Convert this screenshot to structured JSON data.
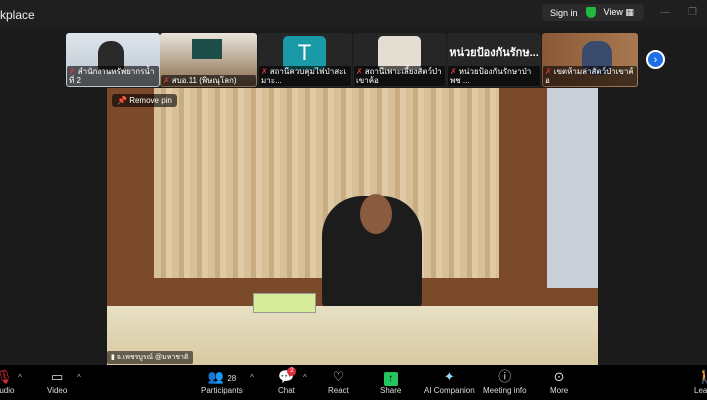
{
  "titlebar": {
    "title": "kplace",
    "sign_in": "Sign in",
    "view": "View"
  },
  "thumbnails": [
    {
      "name": "สำนักงานทรัพยากรน้ำที่ 2",
      "muted": true
    },
    {
      "name": "สบอ.11 (พิษณุโลก)",
      "muted": true
    },
    {
      "name": "สถานีควบคุมไฟป่าสะเมาะ...",
      "muted": true,
      "avatar": "T",
      "avatar_color": "#1a9aa6"
    },
    {
      "name": "สถานีเพาะเลี้ยงสัตว์ป่าเขาค้อ",
      "muted": true,
      "avatar_color": "#e4ddd2"
    },
    {
      "name": "หน่วยป้องกันรักษาป่า พช ...",
      "muted": true,
      "display_name": "หน่วยป้องกันรักษ..."
    },
    {
      "name": "เขตห้ามล่าสัตว์ป่าเขาค้อ",
      "muted": true
    }
  ],
  "main": {
    "remove_pin": "Remove pin",
    "speaker": "จ.เพชรบูรณ์ @มหาชาติ"
  },
  "toolbar": {
    "audio": "Audio",
    "video": "Video",
    "participants": "Participants",
    "participants_count": "28",
    "chat": "Chat",
    "chat_badge": "2",
    "react": "React",
    "share": "Share",
    "ai": "AI Companion",
    "info": "Meeting info",
    "more": "More",
    "leave": "Leave"
  }
}
